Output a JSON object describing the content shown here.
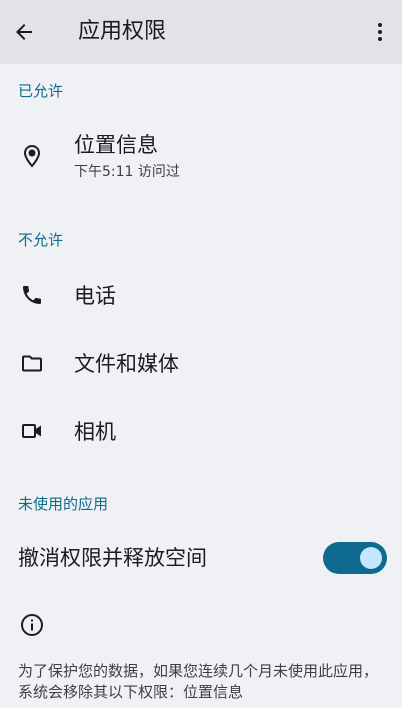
{
  "header": {
    "title": "应用权限",
    "back_icon": "arrow-back-icon",
    "more_icon": "more-vert-icon"
  },
  "allowed": {
    "header": "已允许",
    "items": [
      {
        "label": "位置信息",
        "sub": "下午5:11 访问过",
        "icon": "location-icon"
      }
    ]
  },
  "denied": {
    "header": "不允许",
    "items": [
      {
        "label": "电话",
        "icon": "phone-icon"
      },
      {
        "label": "文件和媒体",
        "icon": "folder-icon"
      },
      {
        "label": "相机",
        "icon": "videocam-icon"
      }
    ]
  },
  "unused": {
    "header": "未使用的应用",
    "toggle_label": "撤消权限并释放空间",
    "toggle_on": true,
    "info_icon": "info-icon",
    "info_text": "为了保护您的数据，如果您连续几个月未使用此应用，系统会移除其以下权限：位置信息"
  },
  "colors": {
    "accent": "#0f6b8a",
    "toggle_track": "#0e6a8f",
    "toggle_thumb": "#c4e7ff",
    "background": "#f0f1f5",
    "topbar": "#e2e3e7"
  }
}
